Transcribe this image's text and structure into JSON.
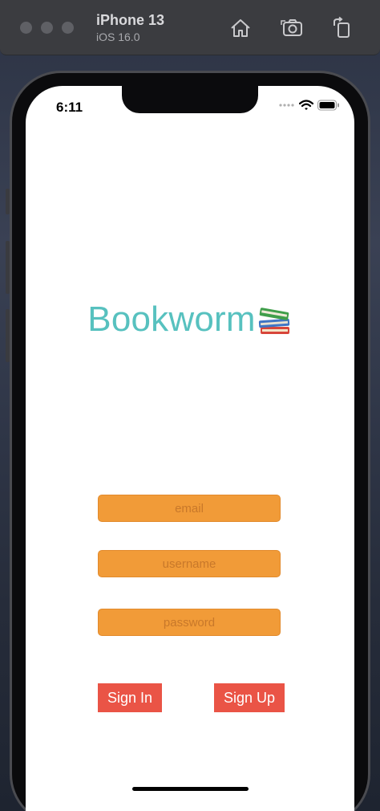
{
  "simulator": {
    "device_name": "iPhone 13",
    "os_version": "iOS 16.0",
    "home_icon": "home-icon",
    "screenshot_icon": "camera-icon",
    "rotate_icon": "rotate-icon"
  },
  "status_bar": {
    "time": "6:11"
  },
  "app": {
    "title": "Bookworm",
    "title_icon": "books-icon",
    "title_color": "#57c1bf",
    "field_color": "#f19b38",
    "button_color": "#ea5446"
  },
  "form": {
    "email": {
      "placeholder": "email",
      "value": ""
    },
    "username": {
      "placeholder": "username",
      "value": ""
    },
    "password": {
      "placeholder": "password",
      "value": ""
    }
  },
  "buttons": {
    "sign_in": "Sign In",
    "sign_up": "Sign Up"
  }
}
